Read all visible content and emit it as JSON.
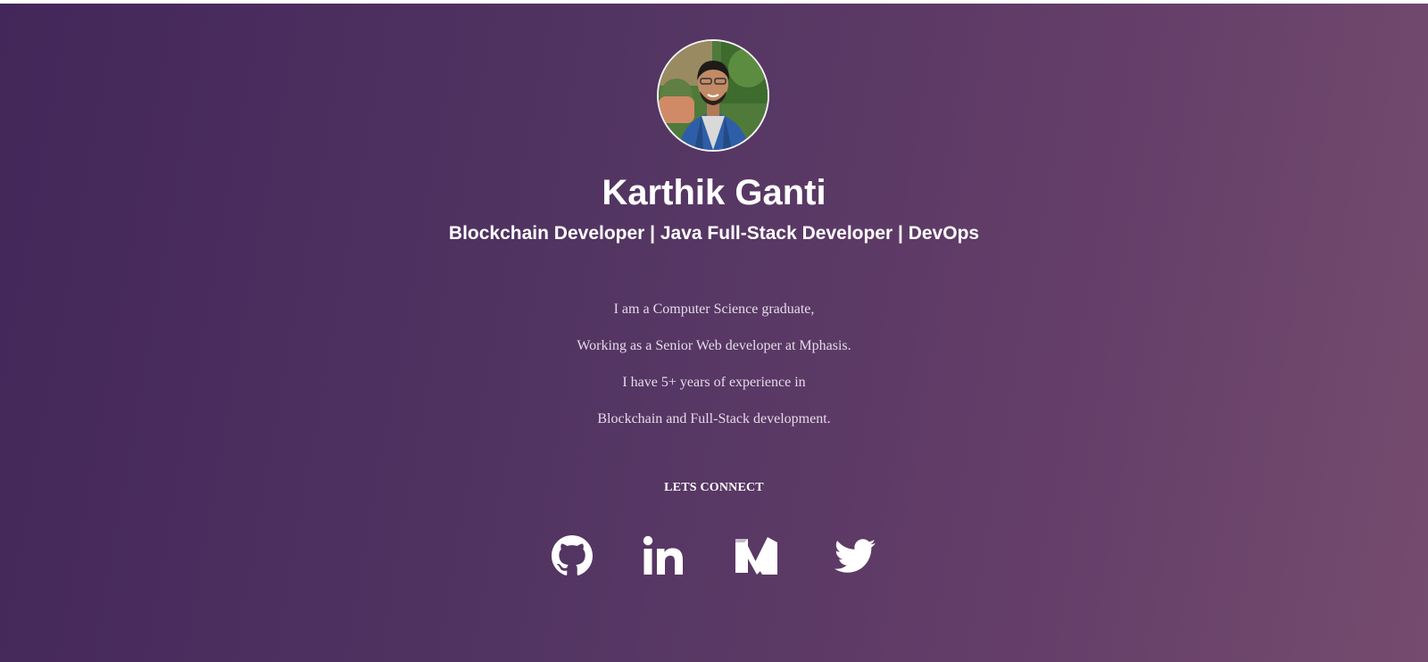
{
  "profile": {
    "avatar_icon": "profile-photo",
    "name": "Karthik Ganti",
    "headline": "Blockchain Developer | Java Full-Stack Developer | DevOps"
  },
  "bio": {
    "lines": [
      "I am a Computer Science graduate,",
      "Working as a Senior Web developer at Mphasis.",
      "I have 5+ years of experience in",
      "Blockchain and Full-Stack development."
    ]
  },
  "connect": {
    "heading": "LETS CONNECT",
    "links": [
      {
        "icon": "github-icon"
      },
      {
        "icon": "linkedin-icon"
      },
      {
        "icon": "medium-icon"
      },
      {
        "icon": "twitter-icon"
      }
    ]
  },
  "colors": {
    "gradient_start": "#43275a",
    "gradient_end": "#754c6f",
    "text": "#ffffff",
    "bio_text": "#e4dbe8"
  }
}
